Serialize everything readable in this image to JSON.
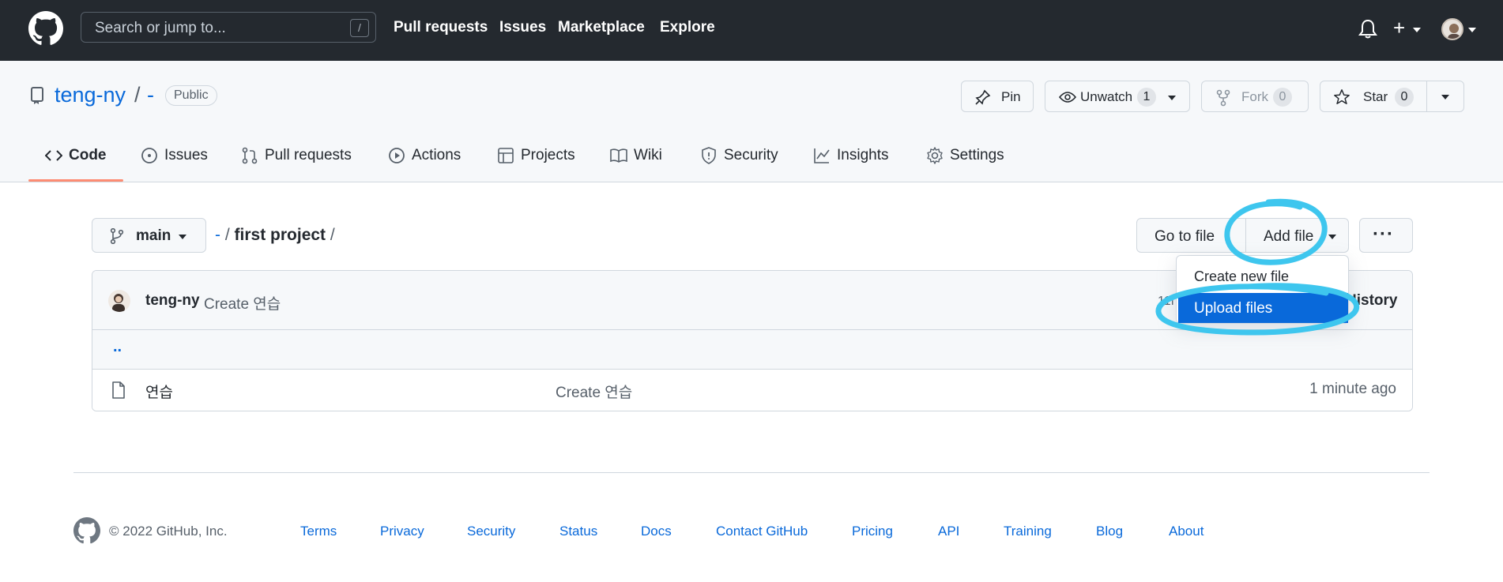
{
  "header": {
    "search_placeholder": "Search or jump to...",
    "search_key": "/",
    "nav": [
      "Pull requests",
      "Issues",
      "Marketplace",
      "Explore"
    ],
    "bg_color": "#24292f"
  },
  "repo": {
    "owner": "teng-ny",
    "separator": "/",
    "name": "-",
    "visibility": "Public",
    "actions": {
      "pin": "Pin",
      "unwatch": "Unwatch",
      "watch_count": "1",
      "fork": "Fork",
      "fork_count": "0",
      "star": "Star",
      "star_count": "0"
    },
    "tabs": [
      {
        "label": "Code",
        "icon": "code-icon",
        "active": true
      },
      {
        "label": "Issues",
        "icon": "issue-icon"
      },
      {
        "label": "Pull requests",
        "icon": "pull-request-icon"
      },
      {
        "label": "Actions",
        "icon": "play-icon"
      },
      {
        "label": "Projects",
        "icon": "table-icon"
      },
      {
        "label": "Wiki",
        "icon": "book-icon"
      },
      {
        "label": "Security",
        "icon": "shield-icon"
      },
      {
        "label": "Insights",
        "icon": "graph-icon"
      },
      {
        "label": "Settings",
        "icon": "gear-icon"
      }
    ]
  },
  "main": {
    "branch": "main",
    "path": {
      "root": "-",
      "sep1": "/",
      "folder": "first project",
      "sep2": "/"
    },
    "go_to_file": "Go to file",
    "add_file": "Add file",
    "more": "···",
    "dropdown": {
      "create_new_file": "Create new file",
      "upload_files": "Upload files"
    },
    "latest_commit": {
      "author": "teng-ny",
      "message": "Create 연습",
      "hash_partial": "11f",
      "history": "History"
    },
    "parent_dir": "..",
    "files": [
      {
        "name": "연습",
        "message": "Create 연습",
        "age": "1 minute ago"
      }
    ]
  },
  "footer": {
    "copyright": "© 2022 GitHub, Inc.",
    "links": [
      "Terms",
      "Privacy",
      "Security",
      "Status",
      "Docs",
      "Contact GitHub",
      "Pricing",
      "API",
      "Training",
      "Blog",
      "About"
    ]
  },
  "colors": {
    "link": "#0969da",
    "active_tab_underline": "#fd8c73",
    "annotation": "#3ec6ee",
    "selected_item": "#0969da"
  }
}
